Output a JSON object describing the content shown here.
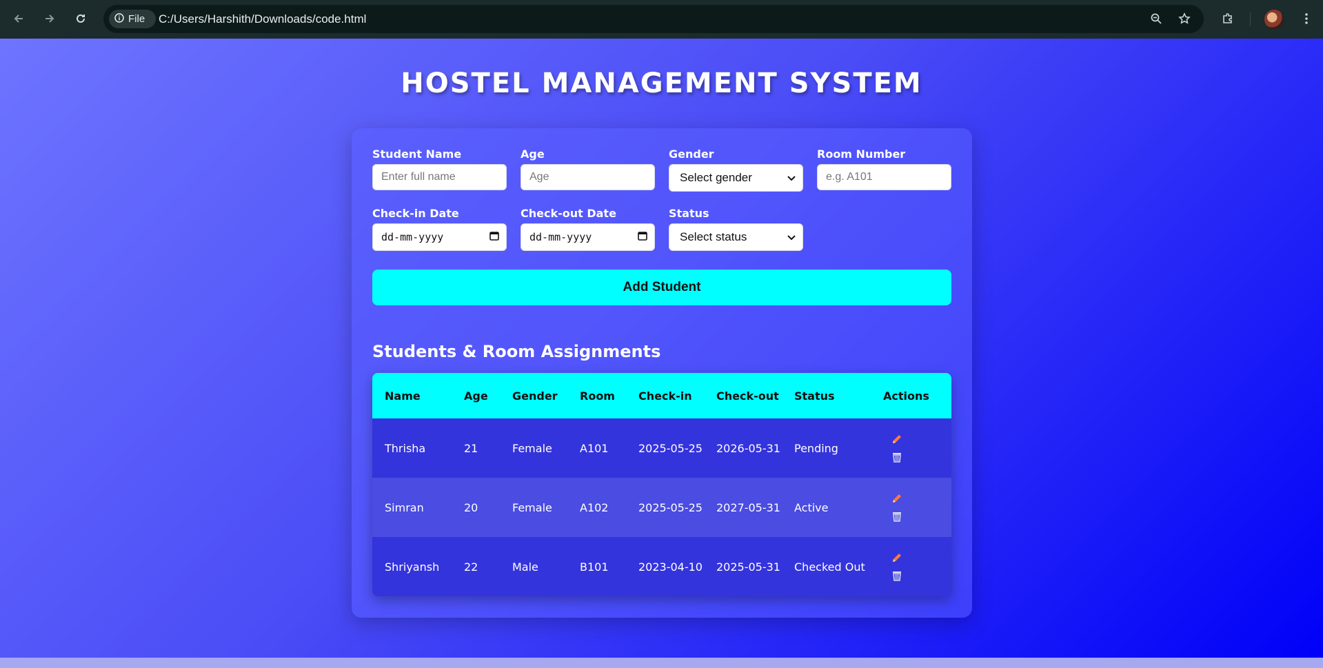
{
  "browser": {
    "file_chip": "File",
    "url": "C:/Users/Harshith/Downloads/code.html"
  },
  "page": {
    "title": "HOSTEL MANAGEMENT SYSTEM"
  },
  "form": {
    "student_name_label": "Student Name",
    "student_name_placeholder": "Enter full name",
    "age_label": "Age",
    "age_placeholder": "Age",
    "gender_label": "Gender",
    "gender_value": "Select gender",
    "room_label": "Room Number",
    "room_placeholder": "e.g. A101",
    "checkin_label": "Check-in Date",
    "checkin_value": "dd-mm-yyyy",
    "checkout_label": "Check-out Date",
    "checkout_value": "dd-mm-yyyy",
    "status_label": "Status",
    "status_value": "Select status",
    "add_button": "Add Student"
  },
  "table": {
    "section_title": "Students & Room Assignments",
    "headers": [
      "Name",
      "Age",
      "Gender",
      "Room",
      "Check-in",
      "Check-out",
      "Status",
      "Actions"
    ],
    "rows": [
      {
        "name": "Thrisha",
        "age": "21",
        "gender": "Female",
        "room": "A101",
        "checkin": "2025-05-25",
        "checkout": "2026-05-31",
        "status": "Pending"
      },
      {
        "name": "Simran",
        "age": "20",
        "gender": "Female",
        "room": "A102",
        "checkin": "2025-05-25",
        "checkout": "2027-05-31",
        "status": "Active"
      },
      {
        "name": "Shriyansh",
        "age": "22",
        "gender": "Male",
        "room": "B101",
        "checkin": "2023-04-10",
        "checkout": "2025-05-31",
        "status": "Checked Out"
      }
    ]
  },
  "icons": {
    "edit": "pencil-icon",
    "delete": "trash-icon"
  },
  "colors": {
    "accent": "#00ffff",
    "edit_icon": "#ff7a3a",
    "delete_icon": "#d8dcf0"
  }
}
